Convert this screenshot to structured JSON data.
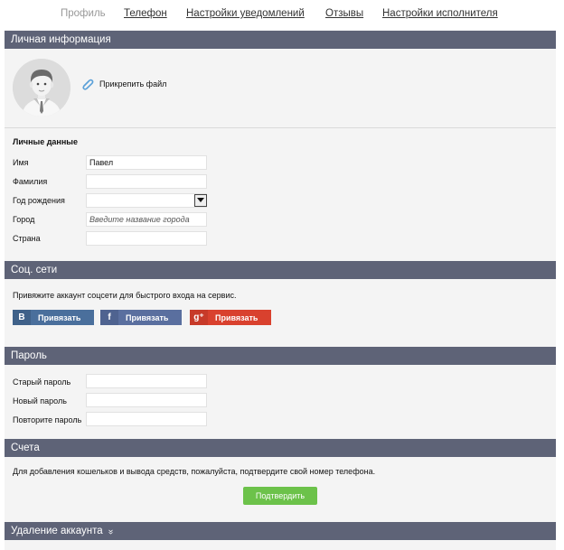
{
  "nav": {
    "tabs": [
      {
        "label": "Профиль",
        "active": true
      },
      {
        "label": "Телефон",
        "active": false
      },
      {
        "label": "Настройки уведомлений",
        "active": false
      },
      {
        "label": "Отзывы",
        "active": false
      },
      {
        "label": "Настройки исполнителя",
        "active": false
      }
    ]
  },
  "personal": {
    "header": "Личная информация",
    "attach_label": "Прикрепить файл",
    "subhead": "Личные данные",
    "first_name_label": "Имя",
    "first_name_value": "Павел",
    "last_name_label": "Фамилия",
    "last_name_value": "",
    "birth_year_label": "Год рождения",
    "birth_year_value": "",
    "city_label": "Город",
    "city_placeholder": "Введите название города",
    "country_label": "Страна",
    "country_value": ""
  },
  "social": {
    "header": "Соц. сети",
    "note": "Привяжите аккаунт соцсети для быстрого входа на сервис.",
    "buttons": [
      {
        "icon": "В",
        "label": "Привязать",
        "color": "#4a6f9c"
      },
      {
        "icon": "f",
        "label": "Привязать",
        "color": "#5a6f9f"
      },
      {
        "icon": "g⁺",
        "label": "Привязать",
        "color": "#d9412e"
      }
    ]
  },
  "password": {
    "header": "Пароль",
    "old_label": "Старый пароль",
    "new_label": "Новый пароль",
    "repeat_label": "Повторите пароль"
  },
  "accounts": {
    "header": "Счета",
    "note": "Для добавления кошельков и вывода средств, пожалуйста, подтвердите свой номер телефона.",
    "confirm_label": "Подтвердить"
  },
  "delete": {
    "header": "Удаление аккаунта",
    "chevron": "»"
  },
  "colors": {
    "header_bg": "#5e6377",
    "confirm_green": "#6cc24a"
  }
}
